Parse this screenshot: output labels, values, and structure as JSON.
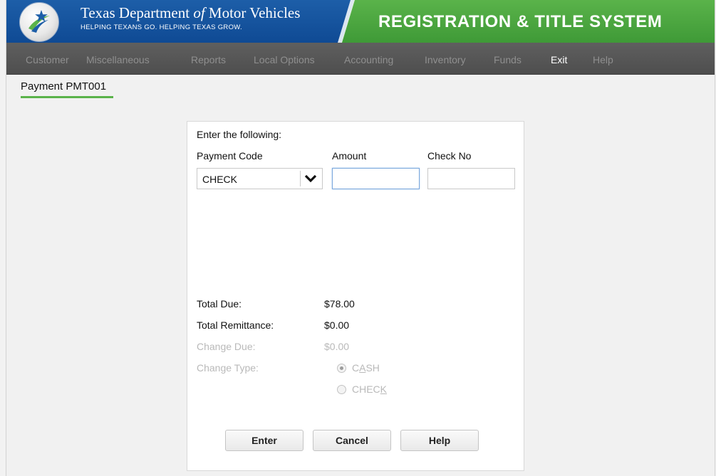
{
  "header": {
    "agency_name_part1": "Texas Department ",
    "agency_name_of": "of",
    "agency_name_part2": " Motor Vehicles",
    "tagline": "HELPING TEXANS GO. HELPING TEXAS GROW.",
    "system_title": "REGISTRATION & TITLE SYSTEM",
    "colors": {
      "blue": "#0f4a94",
      "green": "#4aa83f"
    }
  },
  "nav": {
    "items": [
      {
        "label": "Customer",
        "active": false
      },
      {
        "label": "Miscellaneous",
        "active": false
      },
      {
        "label": "Reports",
        "active": false
      },
      {
        "label": "Local Options",
        "active": false
      },
      {
        "label": "Accounting",
        "active": false
      },
      {
        "label": "Inventory",
        "active": false
      },
      {
        "label": "Funds",
        "active": false
      },
      {
        "label": "Exit",
        "active": true
      },
      {
        "label": "Help",
        "active": false
      }
    ]
  },
  "page": {
    "title": "Payment PMT001"
  },
  "form": {
    "instruction": "Enter the following:",
    "payment_code_label": "Payment Code",
    "amount_label": "Amount",
    "check_no_label": "Check No",
    "payment_code_value": "CHECK",
    "amount_value": "",
    "check_no_value": "",
    "arrow_icon": "chevron-down-icon"
  },
  "totals": {
    "total_due_label": "Total Due:",
    "total_due_value": "$78.00",
    "total_remittance_label": "Total Remittance:",
    "total_remittance_value": "$0.00",
    "change_due_label": "Change Due:",
    "change_due_value": "$0.00",
    "change_type_label": "Change Type:",
    "change_type_options": [
      {
        "label_pre": "C",
        "label_ul": "A",
        "label_post": "SH",
        "selected": true
      },
      {
        "label_pre": "CHEC",
        "label_ul": "K",
        "label_post": "",
        "selected": false
      }
    ]
  },
  "buttons": {
    "enter": "Enter",
    "cancel": "Cancel",
    "help": "Help"
  }
}
